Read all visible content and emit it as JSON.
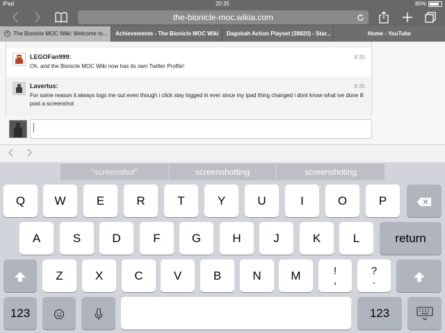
{
  "statusbar": {
    "device": "iPad",
    "wifi_icon": "wifi-icon",
    "time": "20:35",
    "battery_percent": "80%",
    "battery_level": 0.8
  },
  "toolbar": {
    "url": "the-bionicle-moc.wikia.com"
  },
  "tabs": [
    {
      "label": "The Bionicle MOC Wiki: Welcome to...",
      "active": true
    },
    {
      "label": "Achievements - The Bionicle MOC Wiki",
      "active": false
    },
    {
      "label": "Dagobah Action Playset (38820) - Star...",
      "active": false
    },
    {
      "label": "Home - YouTube",
      "active": false
    }
  ],
  "chat": {
    "messages": [
      {
        "user": "LEGOFan999:",
        "time": "8:35",
        "text": "Oh, and the Bionicle MOC Wiki now has its own Twitter Profile!"
      },
      {
        "user": "Lavertus:",
        "time": "8:35",
        "text": "For some reason it always logs me out even though i click stay logged in ever since my ipad thing changed i dont know what ive done ill post a screenshot"
      }
    ],
    "input_value": ""
  },
  "keyboard": {
    "suggestions": [
      "“screenshot”",
      "screenshotting",
      "screenshoting"
    ],
    "row1": [
      "Q",
      "W",
      "E",
      "R",
      "T",
      "Y",
      "U",
      "I",
      "O",
      "P"
    ],
    "row2": [
      "A",
      "S",
      "D",
      "F",
      "G",
      "H",
      "J",
      "K",
      "L"
    ],
    "row3": [
      "Z",
      "X",
      "C",
      "V",
      "B",
      "N",
      "M"
    ],
    "return_label": "return",
    "numbers_label": "123",
    "exclaim_top": "!",
    "exclaim_bottom": ",",
    "question_top": "?",
    "question_bottom": "."
  }
}
